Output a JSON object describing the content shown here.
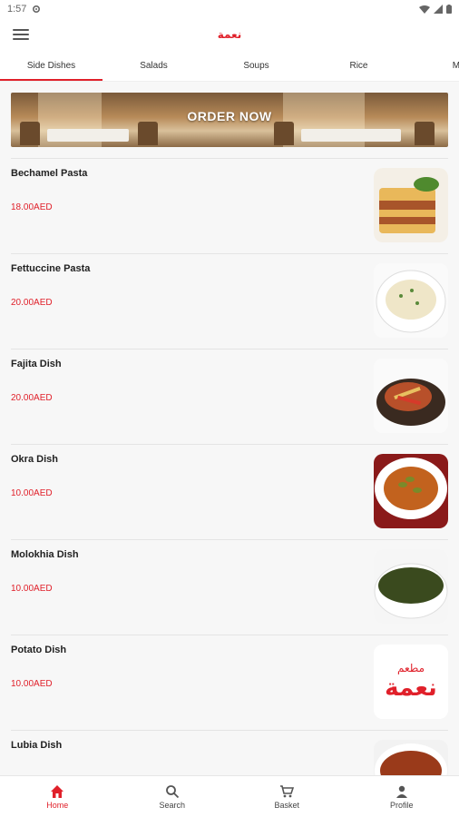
{
  "status_bar": {
    "time": "1:57"
  },
  "app_bar": {
    "title": "نعمة"
  },
  "tabs": [
    {
      "label": "Side Dishes",
      "active": true
    },
    {
      "label": "Salads",
      "active": false
    },
    {
      "label": "Soups",
      "active": false
    },
    {
      "label": "Rice",
      "active": false
    },
    {
      "label": "Mah",
      "active": false
    }
  ],
  "banner": {
    "text": "ORDER NOW"
  },
  "menu_items": [
    {
      "name": "Bechamel Pasta",
      "price": "18.00AED"
    },
    {
      "name": "Fettuccine Pasta",
      "price": "20.00AED"
    },
    {
      "name": "Fajita Dish",
      "price": "20.00AED"
    },
    {
      "name": "Okra Dish",
      "price": "10.00AED"
    },
    {
      "name": "Molokhia Dish",
      "price": "10.00AED"
    },
    {
      "name": "Potato Dish",
      "price": "10.00AED"
    },
    {
      "name": "Lubia Dish",
      "price": ""
    }
  ],
  "logo": {
    "arabic_top": "مطعم",
    "arabic_main": "نعمة"
  },
  "bottom_nav": [
    {
      "label": "Home",
      "icon": "home-icon",
      "active": true
    },
    {
      "label": "Search",
      "icon": "search-icon",
      "active": false
    },
    {
      "label": "Basket",
      "icon": "cart-icon",
      "active": false
    },
    {
      "label": "Profile",
      "icon": "person-icon",
      "active": false
    }
  ],
  "colors": {
    "accent": "#e0202a",
    "background": "#f7f7f7"
  }
}
